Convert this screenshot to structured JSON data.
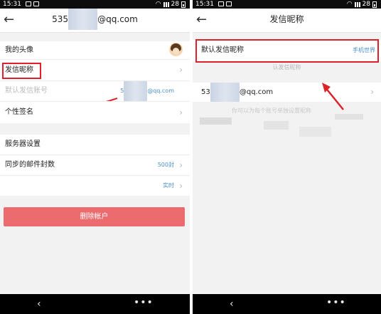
{
  "status": {
    "time": "15:31",
    "battery": "28"
  },
  "left": {
    "header": {
      "title": "535……@qq.com",
      "title_prefix": "535",
      "title_suffix": "@qq.com",
      "back_glyph": "←"
    },
    "rows": {
      "avatar_label": "我的头像",
      "nickname_label": "发信昵称",
      "default_account_label": "默认发信账号",
      "default_account_value_prefix": "5",
      "default_account_value_suffix": "@qq.com",
      "signature_label": "个性签名",
      "server_settings_label": "服务器设置",
      "sync_count_label": "同步的邮件封数",
      "sync_count_value": "500封",
      "sync_mode_value": "实时"
    },
    "delete_button": "删除帐户",
    "chevron": "›"
  },
  "right": {
    "header": {
      "title": "发信昵称",
      "back_glyph": "←"
    },
    "default_nickname_label": "默认发信昵称",
    "default_nickname_value": "手机世界",
    "hint": "认发信昵称",
    "account_prefix": "53",
    "account_suffix": "@qq.com",
    "footer_hint": "你可以为每个账号单独设置昵称",
    "chevron": "›"
  },
  "nav": {
    "back_glyph": "‹",
    "menu_glyph": "•••"
  },
  "colors": {
    "highlight": "#e0202a",
    "link": "#4a90c8",
    "delete": "#ec6b6e"
  }
}
